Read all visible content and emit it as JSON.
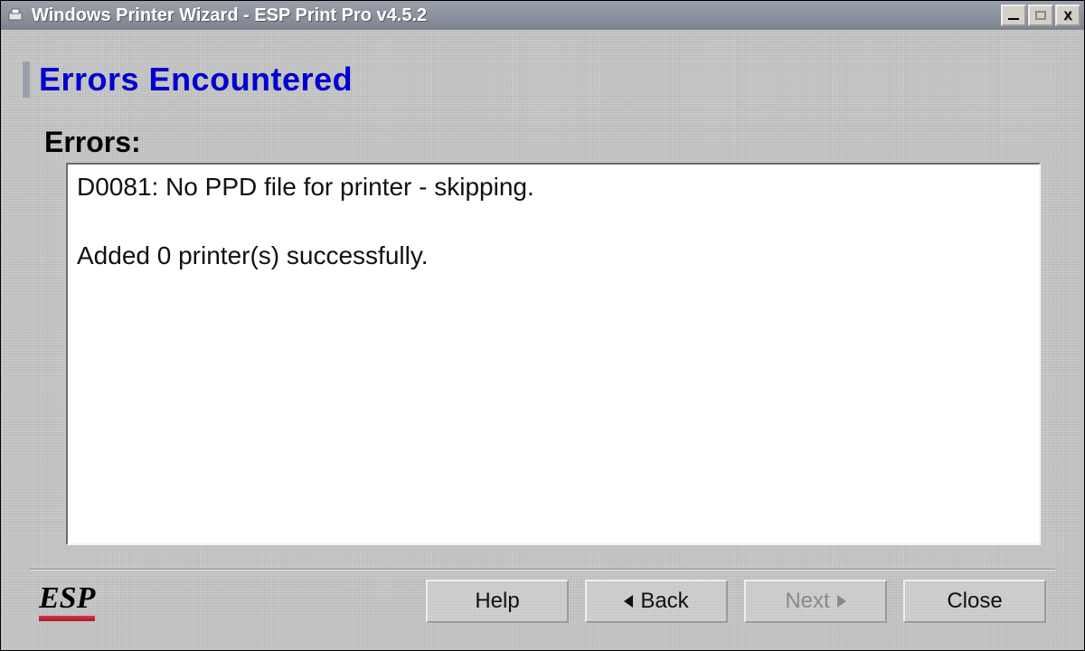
{
  "window": {
    "title": "Windows Printer Wizard - ESP Print Pro v4.5.2"
  },
  "page": {
    "heading": "Errors Encountered",
    "errors_label": "Errors:",
    "errors_text": "D0081: No PPD file for printer - skipping.\n\nAdded 0 printer(s) successfully."
  },
  "footer": {
    "logo_text": "ESP",
    "buttons": {
      "help": "Help",
      "back": "Back",
      "next": "Next",
      "close": "Close"
    },
    "next_enabled": false
  }
}
